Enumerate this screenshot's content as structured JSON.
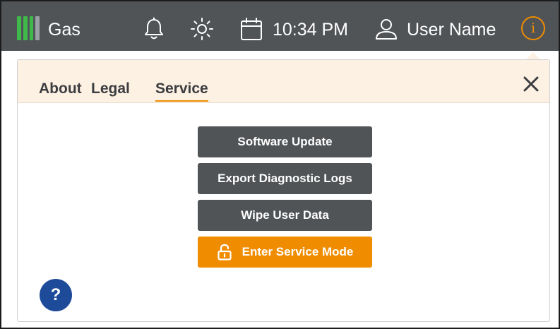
{
  "statusbar": {
    "product_label": "Gas",
    "time": "10:34 PM",
    "user_name": "User Name",
    "info_glyph": "i",
    "icons": [
      "gas-level-icon",
      "bell-icon",
      "sun-icon",
      "calendar-icon",
      "user-icon",
      "info-icon"
    ],
    "colors": {
      "bar_bg": "#515457",
      "gas_bars": [
        "#3fb94a",
        "#3fb94a",
        "#3fb94a",
        "#9aa0a6"
      ],
      "accent": "#f08c00"
    }
  },
  "dialog": {
    "tabs": [
      {
        "label": "About",
        "active": false
      },
      {
        "label": "Legal",
        "active": false
      },
      {
        "label": "Service",
        "active": true
      }
    ],
    "close_glyph": "✕",
    "buttons": [
      {
        "label": "Software Update"
      },
      {
        "label": "Export Diagnostic Logs"
      },
      {
        "label": "Wipe User Data"
      },
      {
        "label": "Enter Service Mode",
        "icon": "lock-icon"
      }
    ],
    "help_glyph": "?",
    "colors": {
      "tab_bar_bg": "#fdf1e3",
      "button_bg": "#515457",
      "primary_button_bg": "#f08c00",
      "help_bg": "#1e4a9a"
    }
  }
}
